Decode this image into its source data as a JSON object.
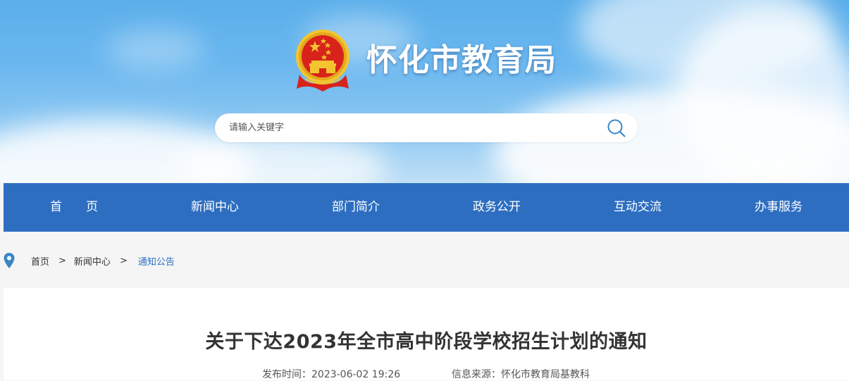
{
  "header": {
    "site_title": "怀化市教育局",
    "emblem_icon": "national-emblem-icon",
    "search": {
      "placeholder": "请输入关键字",
      "value": "",
      "icon": "search-icon"
    }
  },
  "nav": {
    "items": [
      {
        "label": "首　　页"
      },
      {
        "label": "新闻中心"
      },
      {
        "label": "部门简介"
      },
      {
        "label": "政务公开"
      },
      {
        "label": "互动交流"
      },
      {
        "label": "办事服务"
      }
    ]
  },
  "breadcrumb": {
    "icon": "location-pin-icon",
    "items": [
      "首页",
      "新闻中心",
      "通知公告"
    ],
    "separator": ">"
  },
  "article": {
    "title": "关于下达2023年全市高中阶段学校招生计划的通知",
    "publish_time": "发布时间：2023-06-02 19:26",
    "source": "信息来源：怀化市教育局基教科"
  },
  "colors": {
    "nav_bg": "#2d6ec1",
    "accent": "#2d6ec1",
    "emblem_red": "#d8231b",
    "emblem_gold": "#f4c430"
  }
}
